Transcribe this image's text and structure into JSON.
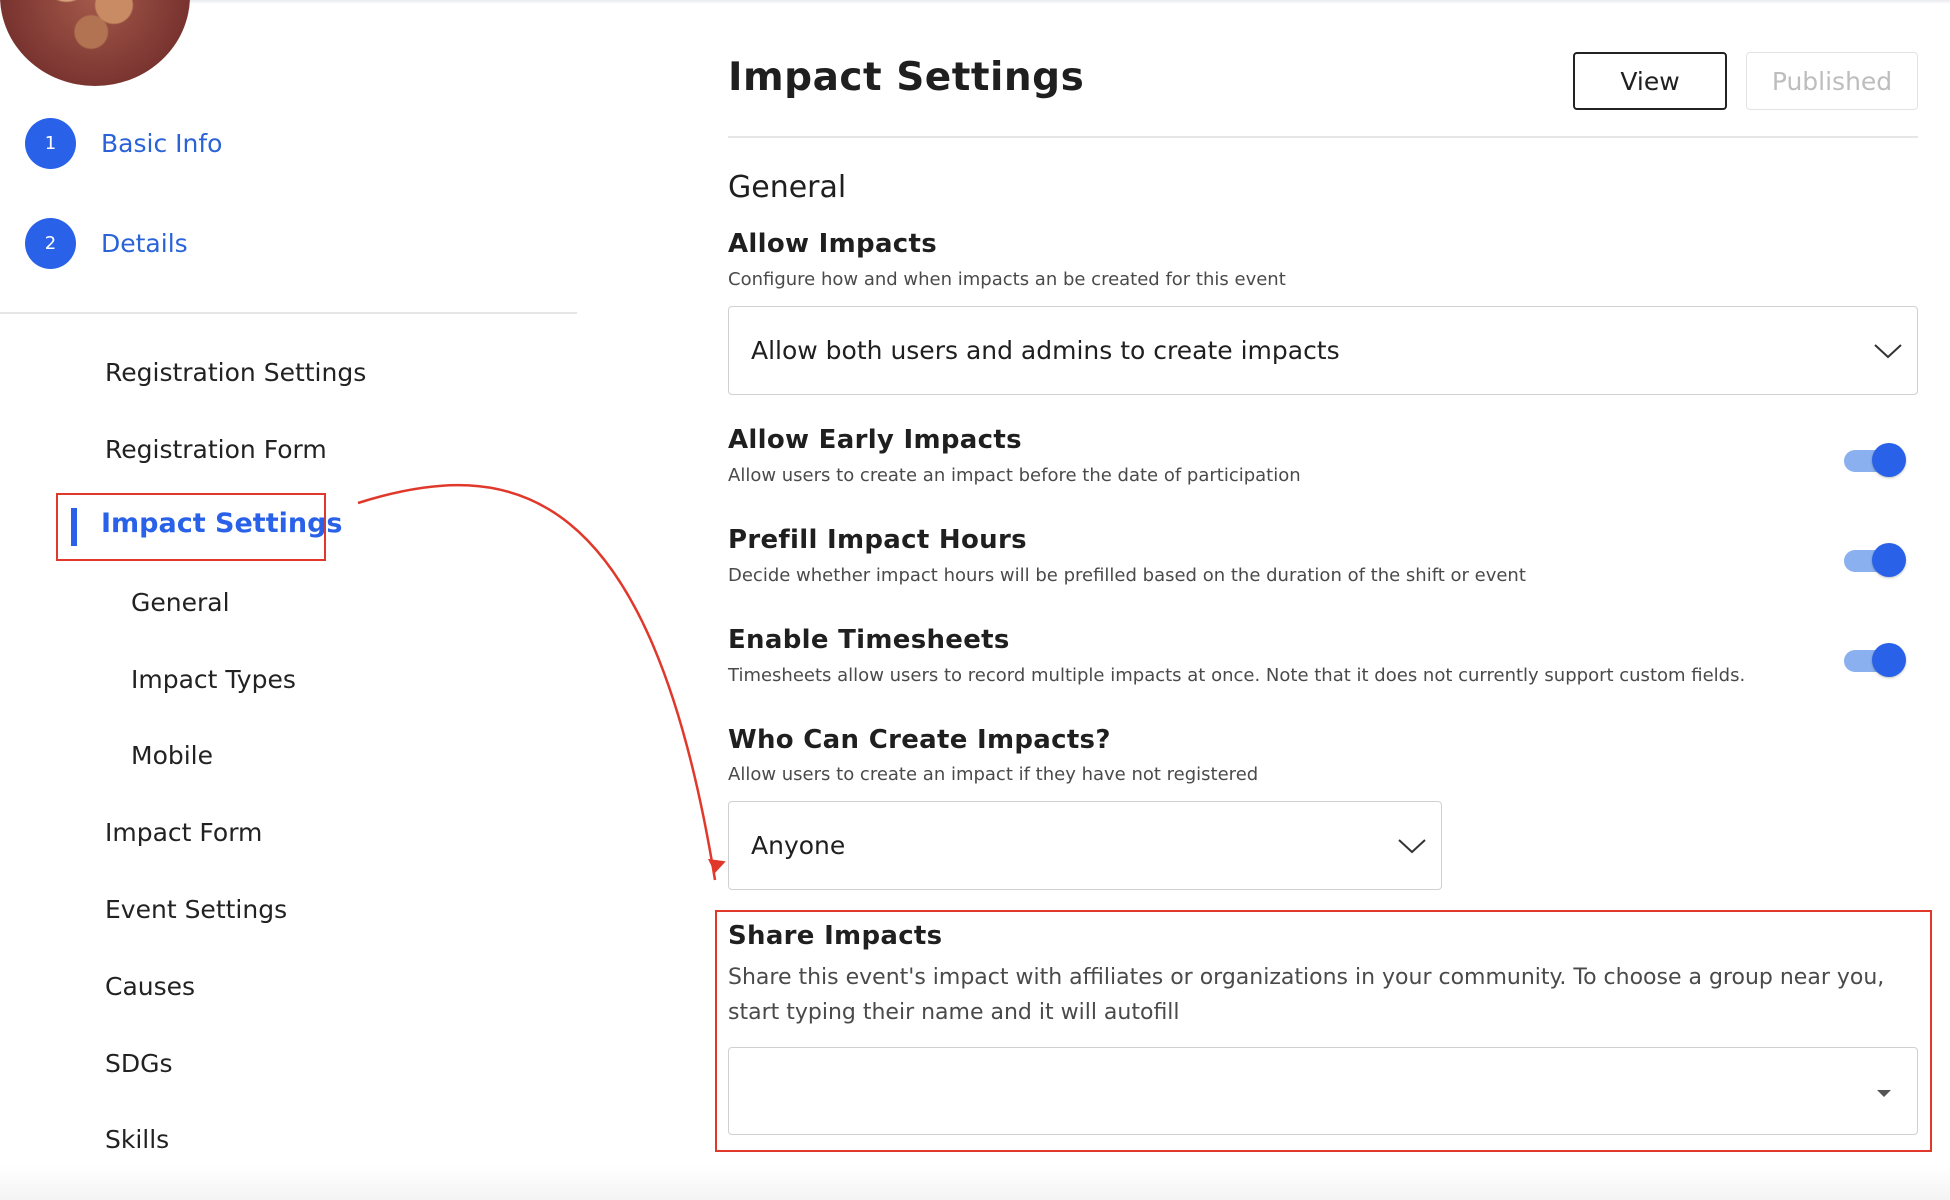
{
  "sidebar": {
    "steps": [
      {
        "number": "1",
        "label": "Basic Info"
      },
      {
        "number": "2",
        "label": "Details"
      }
    ],
    "nav": {
      "registration_settings": "Registration Settings",
      "registration_form": "Registration Form",
      "impact_settings": "Impact Settings",
      "general": "General",
      "impact_types": "Impact Types",
      "mobile": "Mobile",
      "impact_form": "Impact Form",
      "event_settings": "Event Settings",
      "causes": "Causes",
      "sdgs": "SDGs",
      "skills": "Skills"
    },
    "active_item": "impact_settings"
  },
  "header": {
    "title": "Impact Settings",
    "view_button": "View",
    "published_button": "Published"
  },
  "general": {
    "section_title": "General",
    "allow_impacts": {
      "title": "Allow Impacts",
      "description": "Configure how and when impacts an be created for this event",
      "selected": "Allow both users and admins to create impacts"
    },
    "allow_early_impacts": {
      "title": "Allow Early Impacts",
      "description": "Allow users to create an impact before the date of participation",
      "enabled": true
    },
    "prefill_impact_hours": {
      "title": "Prefill Impact Hours",
      "description": "Decide whether impact hours will be prefilled based on the duration of the shift or event",
      "enabled": true
    },
    "enable_timesheets": {
      "title": "Enable Timesheets",
      "description": "Timesheets allow users to record multiple impacts at once. Note that it does not currently support custom fields.",
      "enabled": true
    },
    "who_can_create": {
      "title": "Who Can Create Impacts?",
      "description": "Allow users to create an impact if they have not registered",
      "selected": "Anyone"
    },
    "share_impacts": {
      "title": "Share Impacts",
      "description": "Share this event's impact with affiliates or organizations in your community. To choose a group near you, start typing their name and it will autofill",
      "value": ""
    }
  },
  "colors": {
    "accent": "#2962e8",
    "annotation": "#e0392b",
    "toggle_track": "#8ab0f0"
  },
  "icons": [
    "chevron-down-icon",
    "caret-down-icon",
    "annotation-arrow"
  ]
}
